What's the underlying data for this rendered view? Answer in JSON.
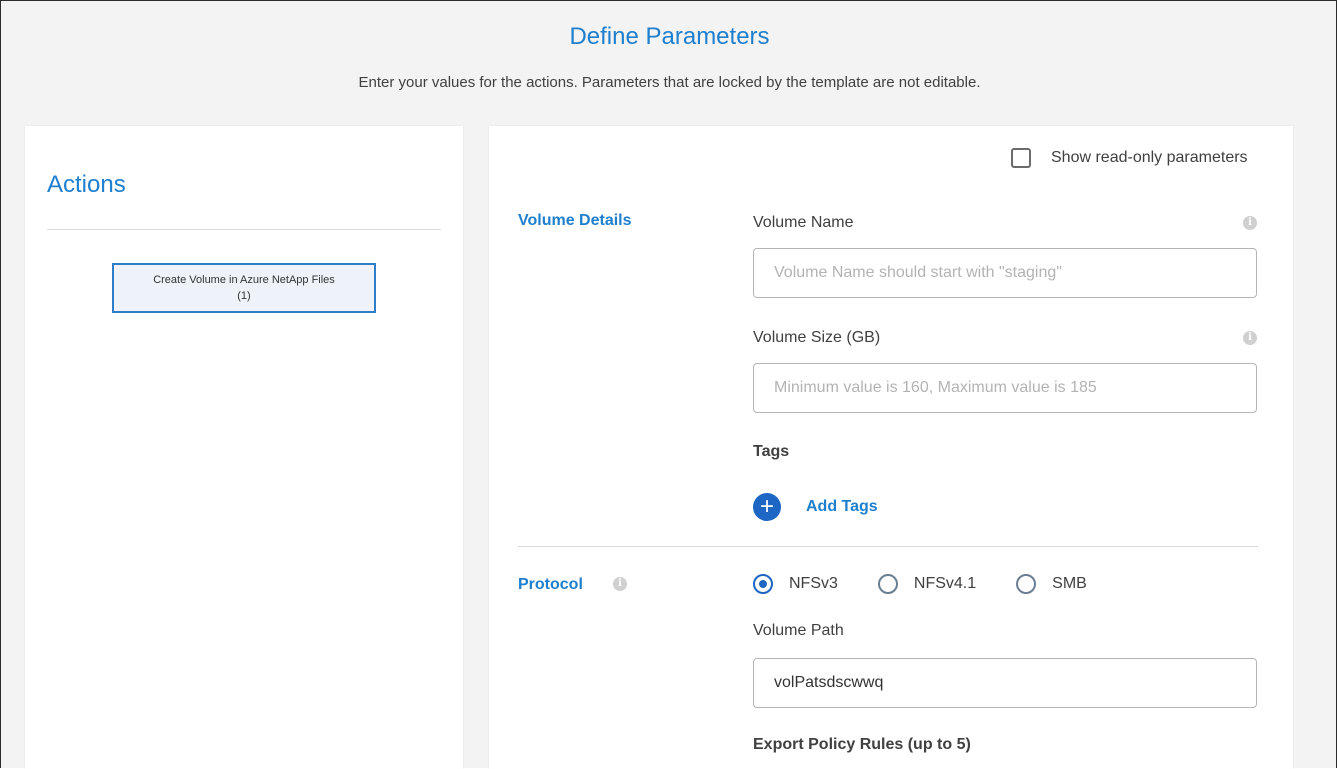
{
  "header": {
    "title": "Define Parameters",
    "subtitle": "Enter your values for the actions. Parameters that are locked by the template are not editable."
  },
  "actions_panel": {
    "title": "Actions",
    "items": [
      {
        "label_line1": "Create Volume in Azure NetApp Files",
        "label_line2": "(1)"
      }
    ]
  },
  "params_panel": {
    "show_readonly_label": "Show read-only parameters",
    "show_readonly_checked": false,
    "volume_details": {
      "section_label": "Volume Details",
      "volume_name": {
        "label": "Volume Name",
        "value": "",
        "placeholder": "Volume Name should start with \"staging\"",
        "info_icon": "info-icon"
      },
      "volume_size": {
        "label": "Volume Size (GB)",
        "value": "",
        "placeholder": "Minimum value is 160, Maximum value is 185",
        "info_icon": "info-icon"
      },
      "tags": {
        "label": "Tags",
        "add_label": "Add Tags",
        "add_icon": "plus-circle-icon"
      }
    },
    "protocol": {
      "section_label": "Protocol",
      "info_icon": "info-icon",
      "options": [
        {
          "label": "NFSv3",
          "selected": true
        },
        {
          "label": "NFSv4.1",
          "selected": false
        },
        {
          "label": "SMB",
          "selected": false
        }
      ],
      "volume_path": {
        "label": "Volume Path",
        "value": "volPatsdscwwq"
      },
      "export_policy_label": "Export Policy Rules (up to 5)"
    }
  },
  "colors": {
    "accent": "#1e7fce",
    "button_blue": "#1e66c4",
    "background": "#f3f3f3",
    "panel": "#ffffff",
    "text": "#404040"
  }
}
